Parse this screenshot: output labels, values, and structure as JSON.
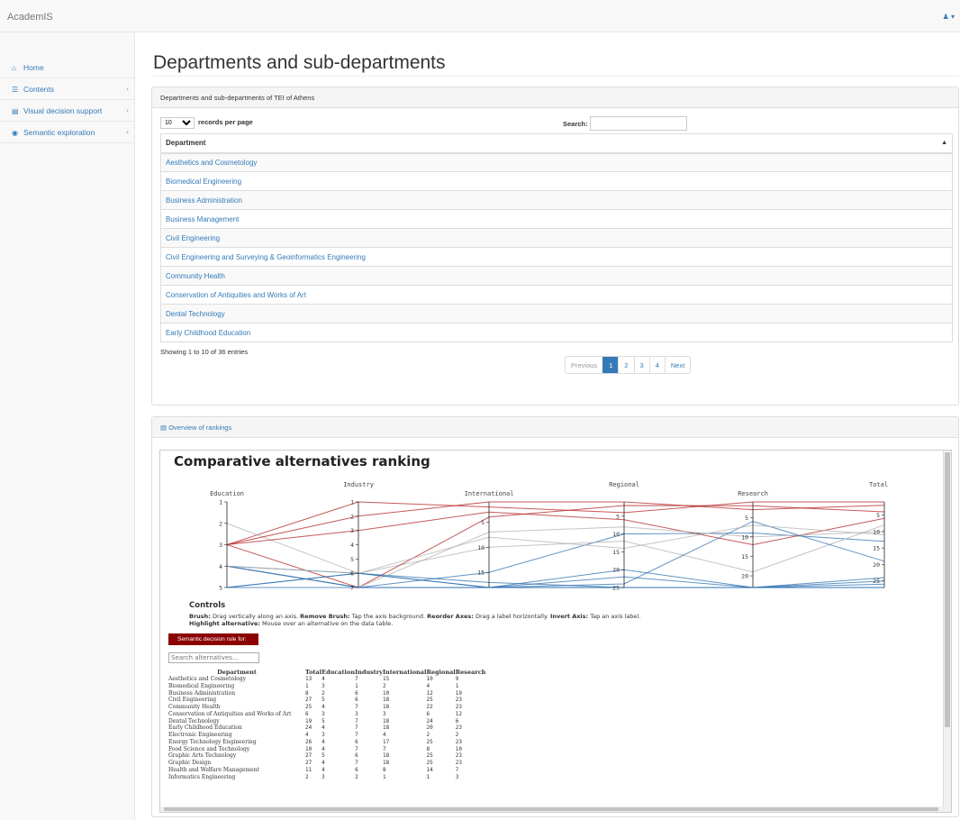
{
  "app": {
    "brand": "AcademIS",
    "user_icon": "user-icon"
  },
  "sidebar": {
    "items": [
      {
        "label": "Home",
        "icon": "home-icon",
        "chevron": ""
      },
      {
        "label": "Contents",
        "icon": "list-icon",
        "chevron": "‹"
      },
      {
        "label": "Visual decision support",
        "icon": "chart-icon",
        "chevron": "‹"
      },
      {
        "label": "Semantic exploration",
        "icon": "compass-icon",
        "chevron": "‹"
      }
    ]
  },
  "page": {
    "title": "Departments and sub-departments"
  },
  "departments_panel": {
    "heading": "Departments and sub-departments of TEI of Athens",
    "records_per_page": "10",
    "records_per_page_label": "records per page",
    "search_label": "Search:",
    "search_value": "",
    "column_header": "Department",
    "rows": [
      "Aesthetics and Cosmetology",
      "Biomedical Engineering",
      "Business Administration",
      "Business Management",
      "Civil Engineering",
      "Civil Engineering and Surveying & Geoinformatics Engineering",
      "Community Health",
      "Conservation of Antiquities and Works of Art",
      "Dental Technology",
      "Early Childhood Education"
    ],
    "info": "Showing 1 to 10 of 36 entries",
    "pagination": {
      "previous": "Previous",
      "pages": [
        "1",
        "2",
        "3",
        "4"
      ],
      "active": "1",
      "next": "Next"
    }
  },
  "rankings_panel": {
    "heading": "Overview of rankings",
    "chart_title": "Comparative alternatives ranking",
    "controls_title": "Controls",
    "controls": {
      "brush_label": "Brush:",
      "brush_text": " Drag vertically along an axis. ",
      "remove_label": "Remove Brush:",
      "remove_text": " Tap the axis background. ",
      "reorder_label": "Reorder Axes:",
      "reorder_text": " Drag a label horizontally. ",
      "invert_label": "Invert Axis:",
      "invert_text": " Tap an axis label.",
      "highlight_label": "Highlight alternative:",
      "highlight_text": " Mouse over an alternative on the data table."
    },
    "semantic_button": "Semantic decision rule for:",
    "search_placeholder": "Search alternatives...",
    "table_headers": [
      "Department",
      "Total",
      "Education",
      "Industry",
      "International",
      "Regional",
      "Research"
    ],
    "table_rows": [
      [
        "Aesthetics and Cosmetology",
        "13",
        "4",
        "7",
        "15",
        "10",
        "9"
      ],
      [
        "Biomedical Engineering",
        "1",
        "3",
        "1",
        "2",
        "4",
        "1"
      ],
      [
        "Business Administration",
        "8",
        "2",
        "6",
        "10",
        "12",
        "19"
      ],
      [
        "Civil Engineering",
        "27",
        "5",
        "6",
        "18",
        "25",
        "23"
      ],
      [
        "Community Health",
        "25",
        "4",
        "7",
        "18",
        "22",
        "23"
      ],
      [
        "Conservation of Antiquities and Works of Art",
        "6",
        "3",
        "3",
        "3",
        "6",
        "12"
      ],
      [
        "Dental Technology",
        "19",
        "5",
        "7",
        "18",
        "24",
        "6"
      ],
      [
        "Early Childhood Education",
        "24",
        "4",
        "7",
        "18",
        "20",
        "23"
      ],
      [
        "Electronic Engineering",
        "4",
        "3",
        "7",
        "4",
        "2",
        "2"
      ],
      [
        "Energy Technology Engineering",
        "26",
        "4",
        "6",
        "17",
        "25",
        "23"
      ],
      [
        "Food Science and Technology",
        "10",
        "4",
        "7",
        "7",
        "8",
        "10"
      ],
      [
        "Graphic Arts Technology",
        "27",
        "5",
        "6",
        "18",
        "25",
        "23"
      ],
      [
        "Graphic Design",
        "27",
        "4",
        "7",
        "18",
        "25",
        "23"
      ],
      [
        "Health and Welfare Management",
        "11",
        "4",
        "6",
        "8",
        "14",
        "7"
      ],
      [
        "Informatics Engineering",
        "2",
        "3",
        "2",
        "1",
        "1",
        "3"
      ]
    ]
  },
  "chart_data": {
    "type": "parallel-coordinates",
    "title": "Comparative alternatives ranking",
    "axes": [
      {
        "name": "Education",
        "ticks": [
          "1",
          "2",
          "3",
          "4",
          "5"
        ],
        "range": [
          1,
          5
        ]
      },
      {
        "name": "Industry",
        "ticks": [
          "1",
          "2",
          "3",
          "4",
          "5",
          "6",
          "7"
        ],
        "range": [
          1,
          7
        ]
      },
      {
        "name": "International",
        "ticks": [
          "5",
          "10",
          "15"
        ],
        "range": [
          1,
          18
        ]
      },
      {
        "name": "Regional",
        "ticks": [
          "5",
          "10",
          "15",
          "20",
          "25"
        ],
        "range": [
          1,
          25
        ]
      },
      {
        "name": "Research",
        "ticks": [
          "5",
          "10",
          "15",
          "20"
        ],
        "range": [
          1,
          23
        ]
      },
      {
        "name": "Total",
        "ticks": [
          "5",
          "10",
          "15",
          "20",
          "25"
        ],
        "range": [
          1,
          27
        ]
      }
    ],
    "colors": {
      "low": "#2c6fb0",
      "mid": "#b0b0b0",
      "high": "#b22222"
    }
  },
  "colors": {
    "link": "#337ab7",
    "accent": "#8b0000",
    "active_page": "#337ab7"
  }
}
